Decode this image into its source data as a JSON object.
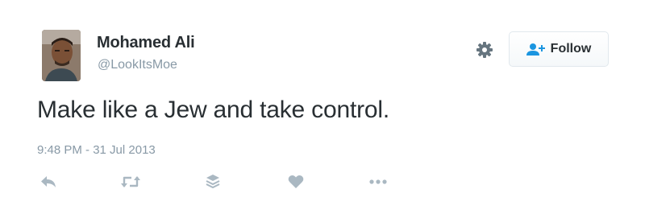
{
  "user": {
    "display_name": "Mohamed Ali",
    "screen_name": "@LookItsMoe"
  },
  "follow_button": {
    "label": "Follow",
    "icon": "add-user-icon"
  },
  "settings_icon": "gear-icon",
  "tweet": {
    "text": "Make like a Jew and take control.",
    "timestamp": "9:48 PM - 31 Jul 2013"
  },
  "actions": [
    {
      "name": "reply",
      "icon": "reply-icon"
    },
    {
      "name": "retweet",
      "icon": "retweet-icon"
    },
    {
      "name": "stack",
      "icon": "stack-icon"
    },
    {
      "name": "like",
      "icon": "heart-icon"
    },
    {
      "name": "more",
      "icon": "more-icon"
    }
  ],
  "colors": {
    "text": "#292f33",
    "muted": "#8899a6",
    "accent": "#1b95e0",
    "icon": "#aab8c2"
  }
}
